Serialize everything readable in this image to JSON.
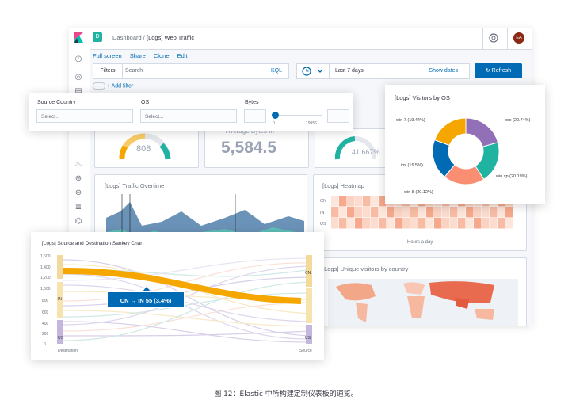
{
  "topbar": {
    "space_initial": "D",
    "breadcrumb_root": "Dashboard",
    "breadcrumb_sep": "/",
    "breadcrumb_current": "[Logs] Web Traffic",
    "user_initials": "EA"
  },
  "app_menu": [
    "Full screen",
    "Share",
    "Clone",
    "Edit"
  ],
  "query_bar": {
    "filters_label": "Filters",
    "search_placeholder": "Search",
    "language_label": "KQL"
  },
  "time_picker": {
    "range": "Last 7 days",
    "show_dates": "Show dates"
  },
  "refresh_label": "Refresh",
  "add_filter": "+ Add filter",
  "controls": {
    "source_country_label": "Source Country",
    "source_country_placeholder": "Select...",
    "os_label": "OS",
    "os_placeholder": "Select...",
    "bytes_label": "Bytes",
    "bytes_min": "0",
    "bytes_max": "19956"
  },
  "metrics": {
    "gauge_value": "808",
    "avg_bytes_title": "Average Bytes In",
    "avg_bytes_value": "5,584.5",
    "percent_value": "41.667%"
  },
  "panels": {
    "traffic_title": "[Logs] Traffic Overtime",
    "heatmap_title": "[Logs] Heatmap",
    "heatmap_rows": [
      "CN",
      "IN",
      "US"
    ],
    "heatmap_xlabel": "Hours a day",
    "map_title": "[Logs] Unique visitors by country"
  },
  "os_chart": {
    "title": "[Logs] Visitors by OS",
    "colors": {
      "osx": "#9170b8",
      "win xp": "#20b3a2",
      "win 8": "#f98e72",
      "ios": "#006bb4",
      "win 7": "#f5a700"
    }
  },
  "chart_data": {
    "type": "pie",
    "title": "[Logs] Visitors by OS",
    "categories": [
      "osx",
      "win xp",
      "win 8",
      "ios",
      "win 7"
    ],
    "values": [
      20.74,
      20.19,
      20.12,
      19.5,
      19.44
    ],
    "labels": [
      "osx (20.74%)",
      "win xp (20.19%)",
      "win 8 (20.12%)",
      "ios (19.5%)",
      "win 7 (19.44%)"
    ],
    "donut": true
  },
  "sankey": {
    "title": "[Logs] Source and Destination Sankey Chart",
    "y_ticks": [
      "1,600",
      "1,400",
      "1,200",
      "1,000",
      "800",
      "600",
      "400",
      "200",
      "0"
    ],
    "left_nodes": [
      "IN",
      "US"
    ],
    "right_nodes": [
      "CN",
      "US"
    ],
    "tooltip": "CN → IN 55 (3.4%)",
    "x_left_label": "Destination",
    "x_right_label": "Source"
  },
  "caption": "图 12：Elastic 中所构建定制仪表板的速览。"
}
